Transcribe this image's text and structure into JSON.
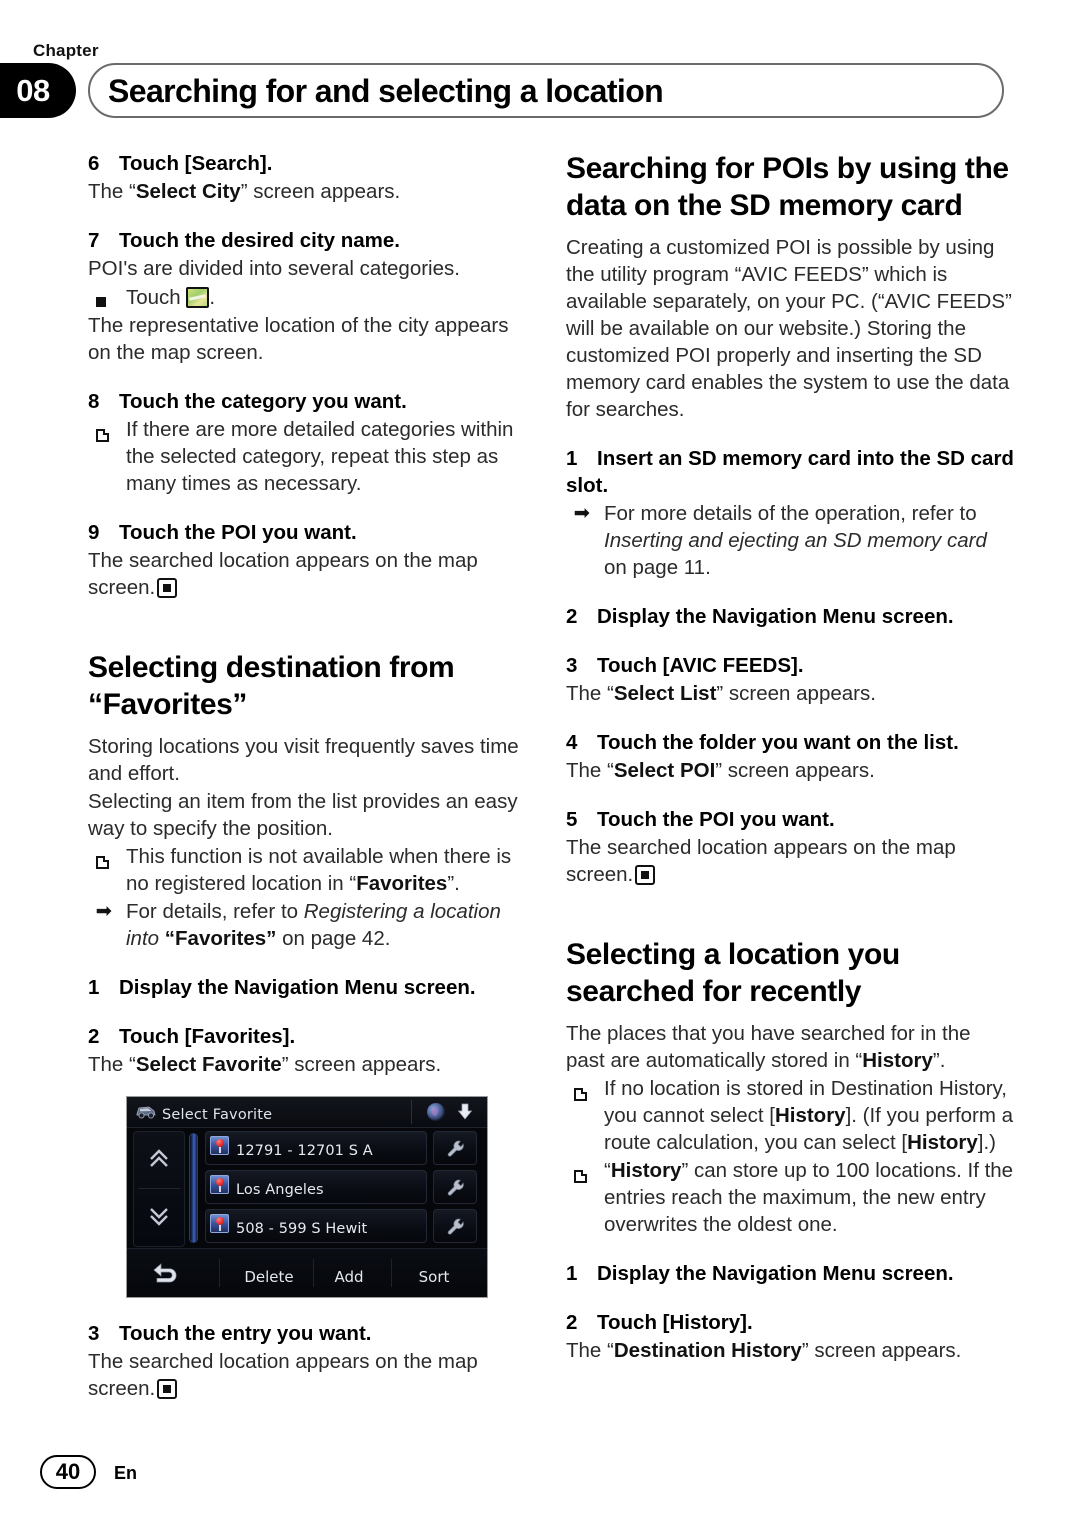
{
  "header": {
    "chapter_label": "Chapter",
    "chapter_number": "08",
    "title": "Searching for and selecting a location"
  },
  "left_column": {
    "step6": {
      "num": "6",
      "title": "Touch [Search].",
      "body_pre": "The “",
      "body_bold": "Select City",
      "body_post": "” screen appears."
    },
    "step7": {
      "num": "7",
      "title": "Touch the desired city name.",
      "body1": "POI's are divided into several categories.",
      "bullet_touch": "Touch",
      "bullet_touch_end": ".",
      "body2": "The representative location of the city appears on the map screen."
    },
    "step8": {
      "num": "8",
      "title": "Touch the category you want.",
      "note": "If there are more detailed categories within the selected category, repeat this step as many times as necessary."
    },
    "step9": {
      "num": "9",
      "title": "Touch the POI you want.",
      "body": "The searched location appears on the map screen."
    },
    "section_favorites": {
      "heading": "Selecting destination from “Favorites”",
      "para1": "Storing locations you visit frequently saves time and effort.",
      "para2": "Selecting an item from the list provides an easy way to specify the position.",
      "note1_pre": "This function is not available when there is no registered location in “",
      "note1_bold": "Favorites",
      "note1_post": "”.",
      "ref1_pre": "For details, refer to ",
      "ref1_italic": "Registering a location into",
      "ref1_bold": "“Favorites”",
      "ref1_post": " on page 42.",
      "step1": {
        "num": "1",
        "title": "Display the  Navigation Menu  screen."
      },
      "step2": {
        "num": "2",
        "title": "Touch [Favorites].",
        "body_pre": "The “",
        "body_bold": "Select Favorite",
        "body_post": "” screen appears."
      },
      "step3": {
        "num": "3",
        "title": "Touch the entry you want.",
        "body": "The searched location appears on the map screen."
      }
    },
    "device_screenshot": {
      "title": "Select Favorite",
      "rows": [
        {
          "label": "12791 - 12701 S A"
        },
        {
          "label": "Los Angeles"
        },
        {
          "label": "508 - 599 S Hewit"
        }
      ],
      "buttons": {
        "delete": "Delete",
        "add": "Add",
        "sort": "Sort"
      }
    }
  },
  "right_column": {
    "section_sd": {
      "heading": "Searching for POIs by using the data on the SD memory card",
      "para1": "Creating a customized POI is possible by using the utility program “AVIC FEEDS” which is available separately, on your PC. (“AVIC FEEDS” will be available on our website.) Storing the customized POI properly and inserting the SD memory card enables the system to use the data for searches.",
      "step1": {
        "num": "1",
        "title": "Insert an SD memory card into the SD card slot.",
        "ref_pre": "For more details of the operation, refer to ",
        "ref_italic": "Inserting and ejecting an SD memory card",
        "ref_post": " on page 11."
      },
      "step2": {
        "num": "2",
        "title": "Display the  Navigation Menu  screen."
      },
      "step3": {
        "num": "3",
        "title": "Touch [AVIC FEEDS].",
        "body_pre": "The “",
        "body_bold": "Select List",
        "body_post": "” screen appears."
      },
      "step4": {
        "num": "4",
        "title": "Touch the folder you want on the list.",
        "body_pre": "The “",
        "body_bold": "Select POI",
        "body_post": "” screen appears."
      },
      "step5": {
        "num": "5",
        "title": "Touch the POI you want.",
        "body": "The searched location appears on the map screen."
      }
    },
    "section_history": {
      "heading": "Selecting a location you searched for recently",
      "para1_pre": "The places that you have searched for in the past are automatically stored in “",
      "para1_bold": "History",
      "para1_post": "”.",
      "note1_pre": "If no location is stored in Destination History, you cannot select [",
      "note1_bold1": "History",
      "note1_mid": "]. (If you perform a route calculation, you can select [",
      "note1_bold2": "History",
      "note1_post": "].)",
      "note2_pre": "“",
      "note2_bold": "History",
      "note2_post": "” can store up to 100 locations. If the entries reach the maximum, the new entry overwrites the oldest one.",
      "step1": {
        "num": "1",
        "title": "Display the  Navigation Menu  screen."
      },
      "step2": {
        "num": "2",
        "title": "Touch [History].",
        "body_pre": "The “",
        "body_bold": "Destination History",
        "body_post": "” screen appears."
      }
    }
  },
  "footer": {
    "page_number": "40",
    "language": "En"
  }
}
